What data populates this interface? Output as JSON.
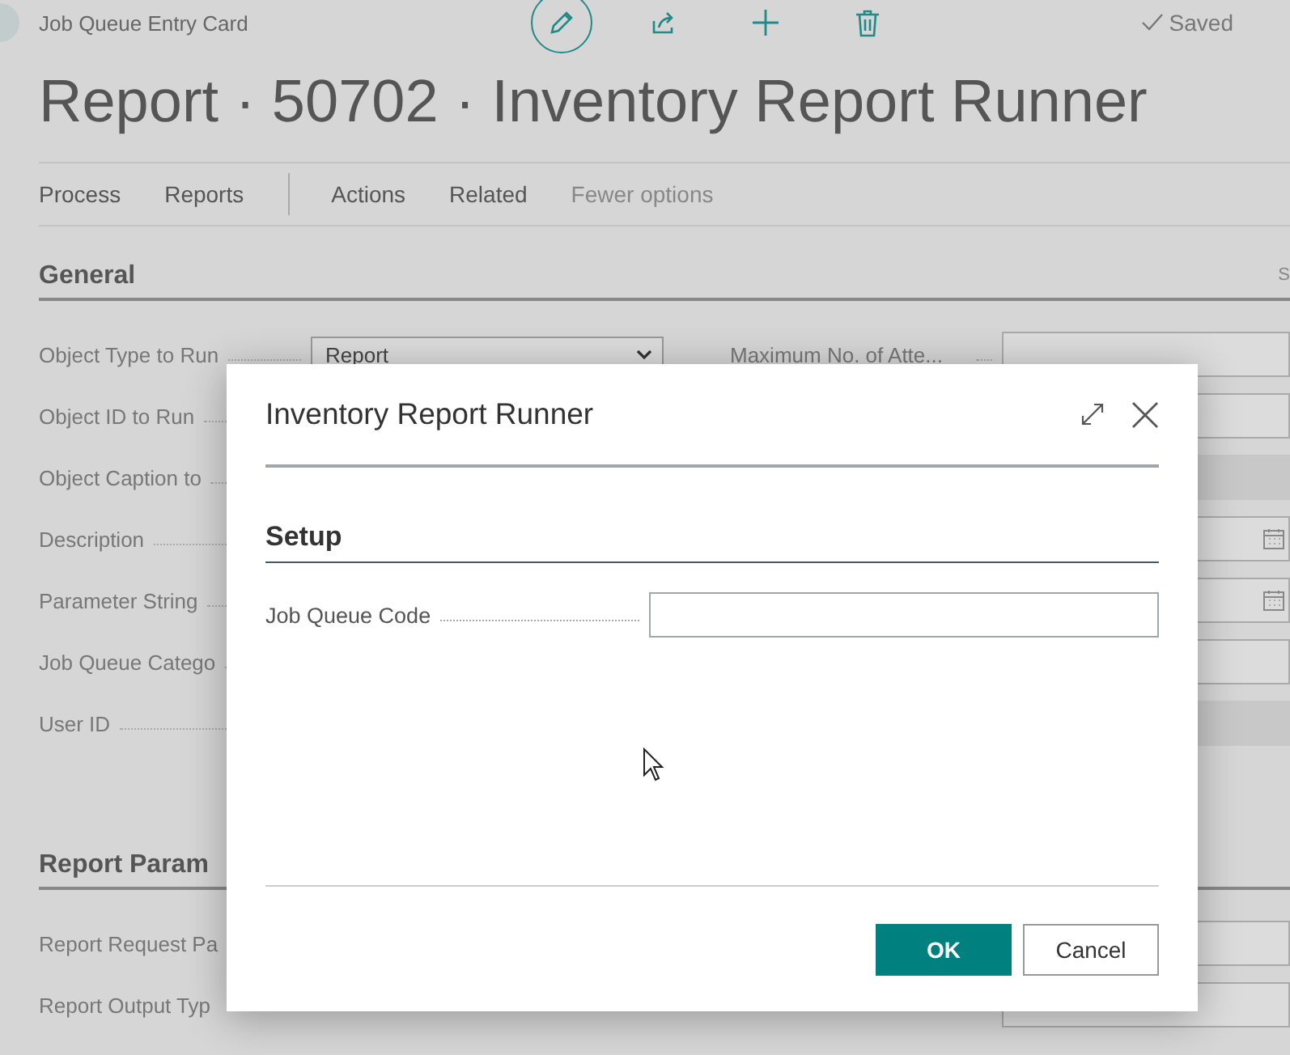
{
  "header": {
    "breadcrumb": "Job Queue Entry Card",
    "status": "Saved"
  },
  "toolbar_icons": [
    {
      "kind": "edit",
      "selected": true
    },
    {
      "kind": "share",
      "selected": false
    },
    {
      "kind": "add",
      "selected": false
    },
    {
      "kind": "delete",
      "selected": false
    }
  ],
  "title": "Report · 50702 · Inventory Report Runner",
  "action_groups": [
    [
      "Process",
      "Reports"
    ],
    [
      "Actions",
      "Related"
    ]
  ],
  "fewer_options": "Fewer options",
  "general": {
    "title": "General",
    "aside": "S",
    "rows": [
      {
        "label": "Object Type to Run",
        "kind": "select",
        "value": "Report"
      },
      {
        "label": "Object ID to Run"
      },
      {
        "label": "Object Caption to"
      },
      {
        "label": "Description"
      },
      {
        "label": "Parameter String"
      },
      {
        "label": "Job Queue Catego"
      },
      {
        "label": "User ID"
      }
    ],
    "right_rows": [
      {
        "label": "Maximum No. of Atte...",
        "kind": "text"
      },
      {
        "kind": "text"
      },
      {
        "kind": "disabled"
      },
      {
        "kind": "date"
      },
      {
        "kind": "date"
      },
      {
        "kind": "text"
      },
      {
        "kind": "disabled"
      }
    ]
  },
  "report_parameters": {
    "title": "Report Param",
    "rows": [
      {
        "label": "Report Request Pa"
      },
      {
        "label": "Report Output Typ"
      }
    ]
  },
  "dialog": {
    "title": "Inventory Report Runner",
    "section": "Setup",
    "fields": [
      {
        "label": "Job Queue Code"
      }
    ],
    "buttons": [
      {
        "label": "OK",
        "kind": "primary"
      },
      {
        "label": "Cancel",
        "kind": "secondary"
      }
    ]
  }
}
